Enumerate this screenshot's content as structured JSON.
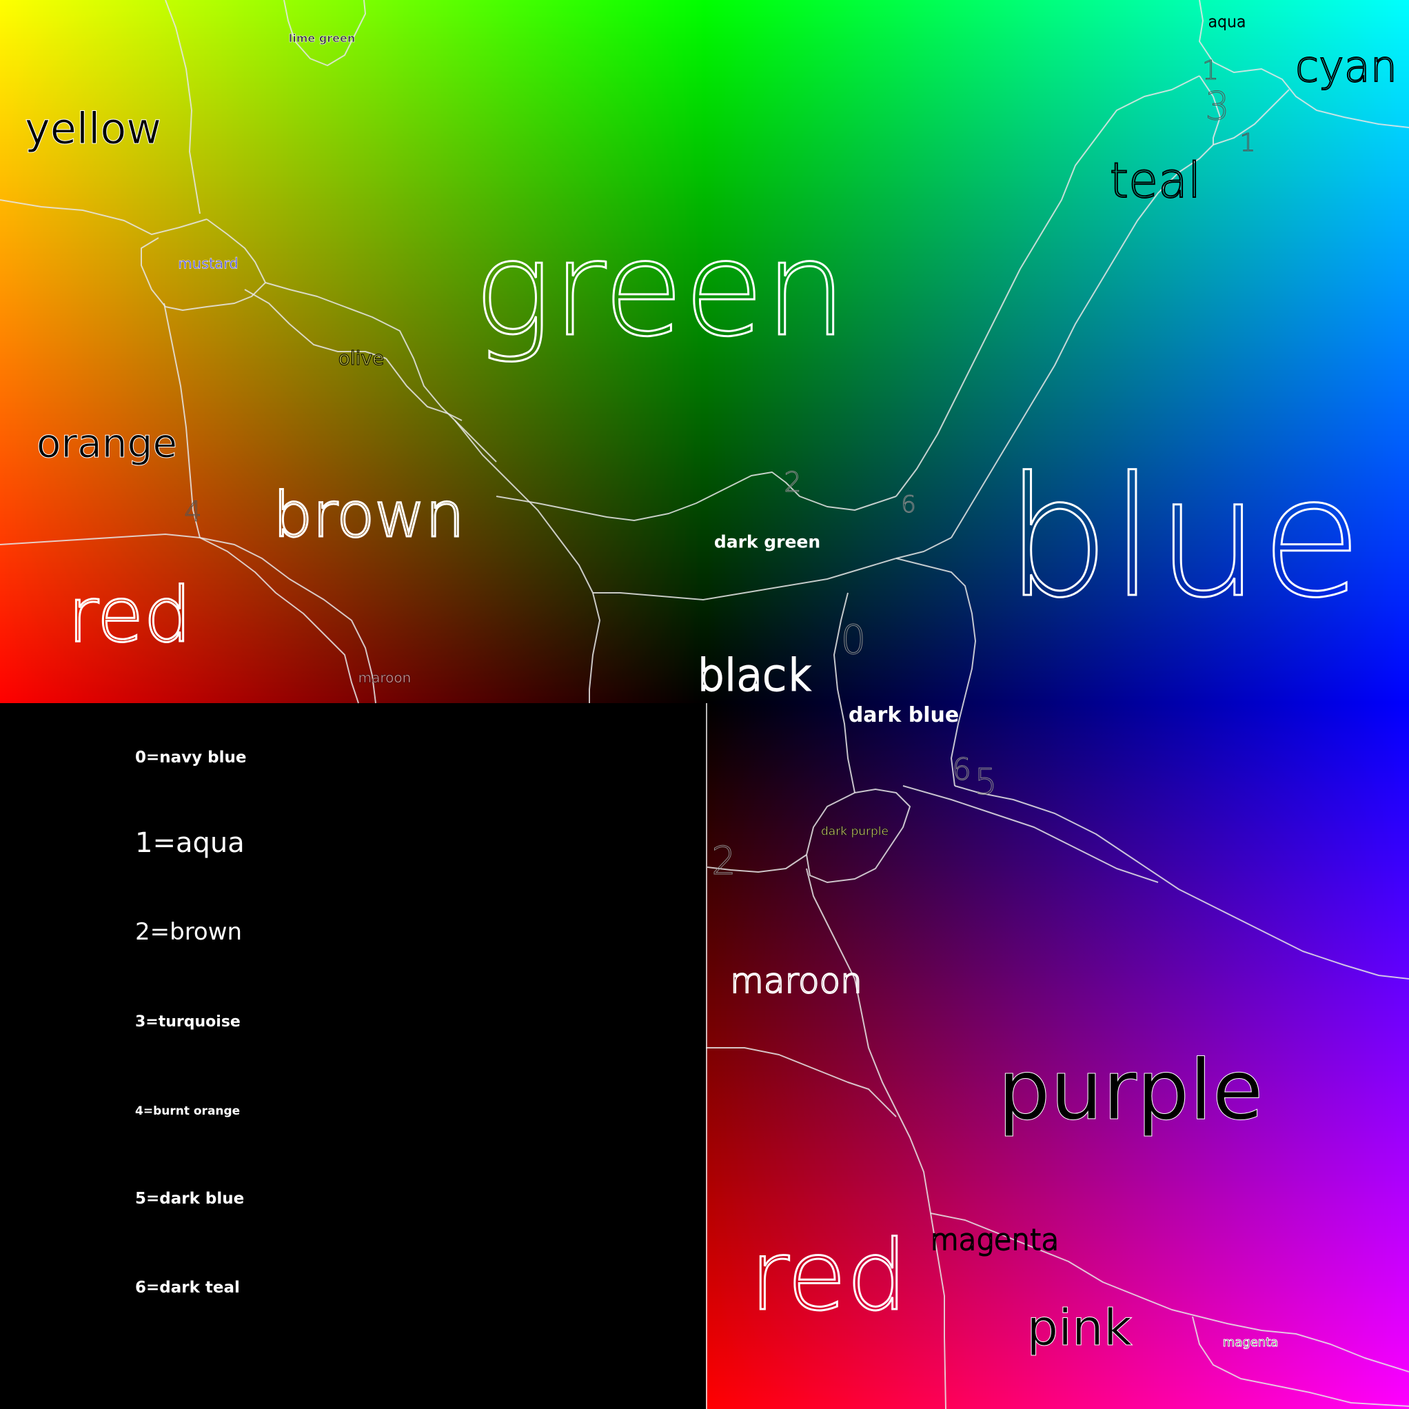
{
  "regions_top": [
    {
      "label": "yellow"
    },
    {
      "label": "lime green"
    },
    {
      "label": "green"
    },
    {
      "label": "aqua"
    },
    {
      "label": "cyan"
    },
    {
      "label": "teal"
    },
    {
      "label": "mustard"
    },
    {
      "label": "olive"
    },
    {
      "label": "orange"
    },
    {
      "label": "brown"
    },
    {
      "label": "red"
    },
    {
      "label": "dark green"
    },
    {
      "label": "blue"
    },
    {
      "label": "black"
    },
    {
      "label": "maroon"
    },
    {
      "label": "dark blue"
    }
  ],
  "regions_bottom": [
    {
      "label": "dark purple"
    },
    {
      "label": "maroon"
    },
    {
      "label": "purple"
    },
    {
      "label": "red"
    },
    {
      "label": "magenta"
    },
    {
      "label": "pink"
    },
    {
      "label": "magenta"
    }
  ],
  "numbered_markers": [
    {
      "label": "0"
    },
    {
      "label": "1"
    },
    {
      "label": "3"
    },
    {
      "label": "1"
    },
    {
      "label": "4"
    },
    {
      "label": "6"
    },
    {
      "label": "2"
    },
    {
      "label": "2"
    },
    {
      "label": "5"
    },
    {
      "label": "6"
    }
  ],
  "legend": [
    {
      "text": "0=navy blue"
    },
    {
      "text": "1=aqua"
    },
    {
      "text": "2=brown"
    },
    {
      "text": "3=turquoise"
    },
    {
      "text": "4=burnt orange"
    },
    {
      "text": "5=dark blue"
    },
    {
      "text": "6=dark teal"
    }
  ]
}
